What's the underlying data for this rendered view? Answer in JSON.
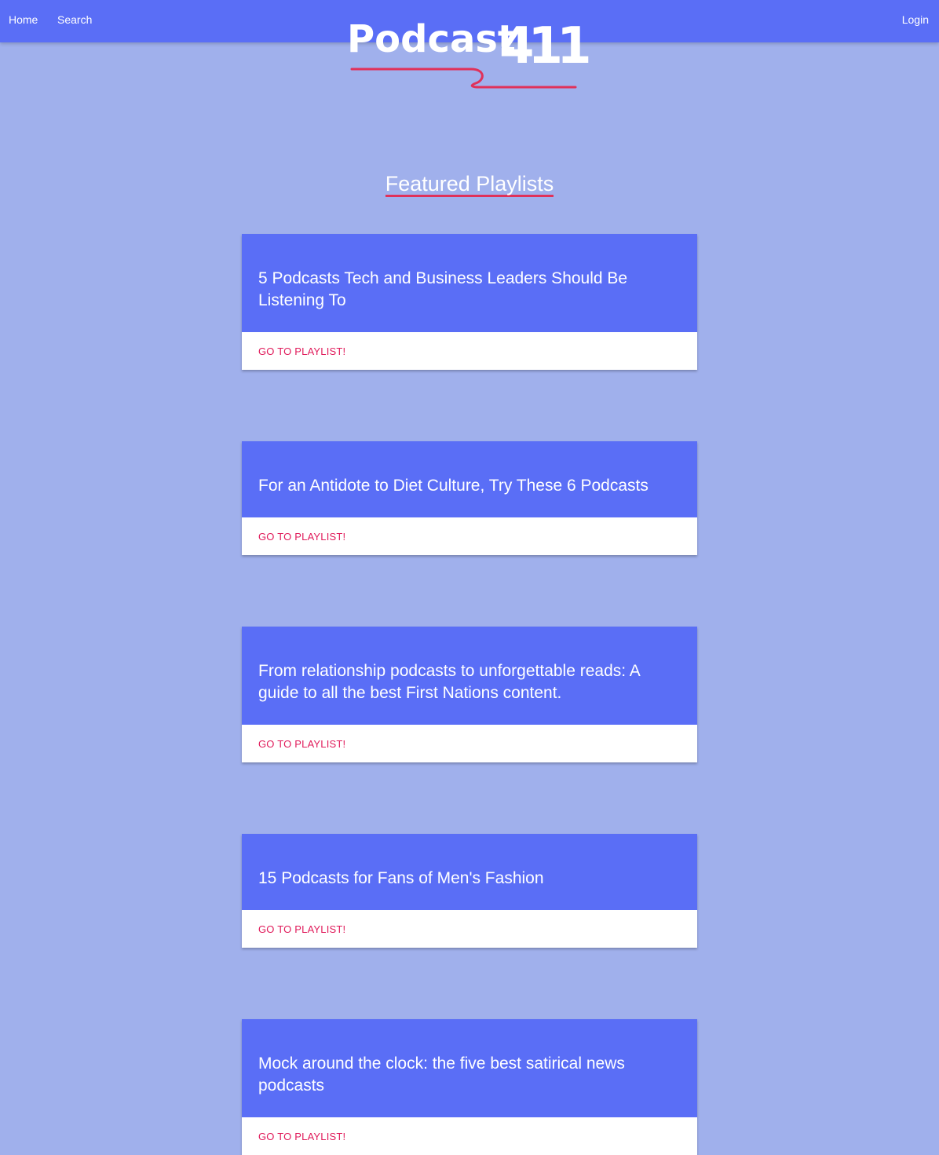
{
  "nav": {
    "home": "Home",
    "search": "Search",
    "login": "Login"
  },
  "logo": {
    "word": "Podcast",
    "number": "411"
  },
  "section_title": "Featured Playlists",
  "playlists": [
    {
      "title": "5 Podcasts Tech and Business Leaders Should Be Listening To",
      "action": "GO TO PLAYLIST!"
    },
    {
      "title": "For an Antidote to Diet Culture, Try These 6 Podcasts",
      "action": "GO TO PLAYLIST!"
    },
    {
      "title": "From relationship podcasts to unforgettable reads: A guide to all the best First Nations content.",
      "action": "GO TO PLAYLIST!"
    },
    {
      "title": "15 Podcasts for Fans of Men's Fashion",
      "action": "GO TO PLAYLIST!"
    },
    {
      "title": "Mock around the clock: the five best satirical news podcasts",
      "action": "GO TO PLAYLIST!"
    }
  ],
  "colors": {
    "background": "#a0b0ec",
    "primary": "#5a6ef6",
    "accent": "#e0315a",
    "link": "#e01a5a"
  }
}
